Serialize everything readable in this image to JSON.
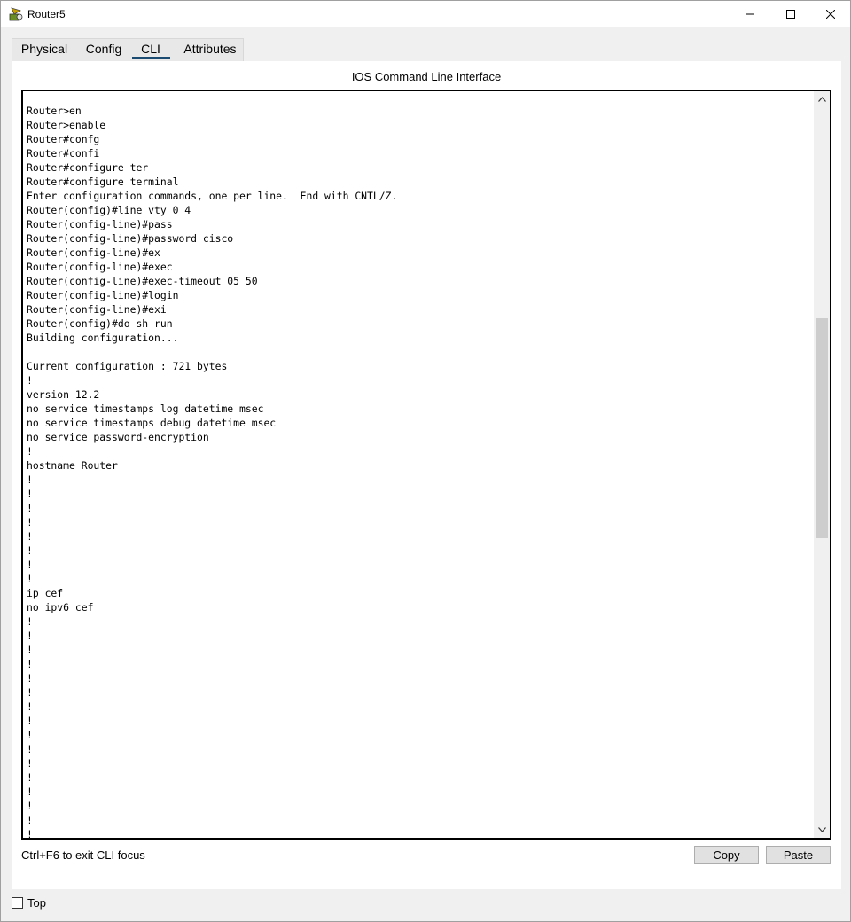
{
  "window": {
    "title": "Router5"
  },
  "tabs": [
    {
      "label": "Physical"
    },
    {
      "label": "Config"
    },
    {
      "label": "CLI"
    },
    {
      "label": "Attributes"
    }
  ],
  "active_tab": "CLI",
  "panel": {
    "title": "IOS Command Line Interface"
  },
  "terminal": {
    "lines": [
      "Router>en",
      "Router>enable",
      "Router#confg",
      "Router#confi",
      "Router#configure ter",
      "Router#configure terminal",
      "Enter configuration commands, one per line.  End with CNTL/Z.",
      "Router(config)#line vty 0 4",
      "Router(config-line)#pass",
      "Router(config-line)#password cisco",
      "Router(config-line)#ex",
      "Router(config-line)#exec",
      "Router(config-line)#exec-timeout 05 50",
      "Router(config-line)#login",
      "Router(config-line)#exi",
      "Router(config)#do sh run",
      "Building configuration...",
      "",
      "Current configuration : 721 bytes",
      "!",
      "version 12.2",
      "no service timestamps log datetime msec",
      "no service timestamps debug datetime msec",
      "no service password-encryption",
      "!",
      "hostname Router",
      "!",
      "!",
      "!",
      "!",
      "!",
      "!",
      "!",
      "!",
      "ip cef",
      "no ipv6 cef",
      "!",
      "!",
      "!",
      "!",
      "!",
      "!",
      "!",
      "!",
      "!",
      "!",
      "!",
      "!",
      "!",
      "!",
      "!",
      "!",
      "!"
    ]
  },
  "hint": "Ctrl+F6 to exit CLI focus",
  "buttons": {
    "copy": "Copy",
    "paste": "Paste"
  },
  "top_checkbox": {
    "label": "Top",
    "checked": false
  },
  "colors": {
    "tab_underline": "#1c4b72",
    "scroll_thumb": "#cdcdcd"
  }
}
